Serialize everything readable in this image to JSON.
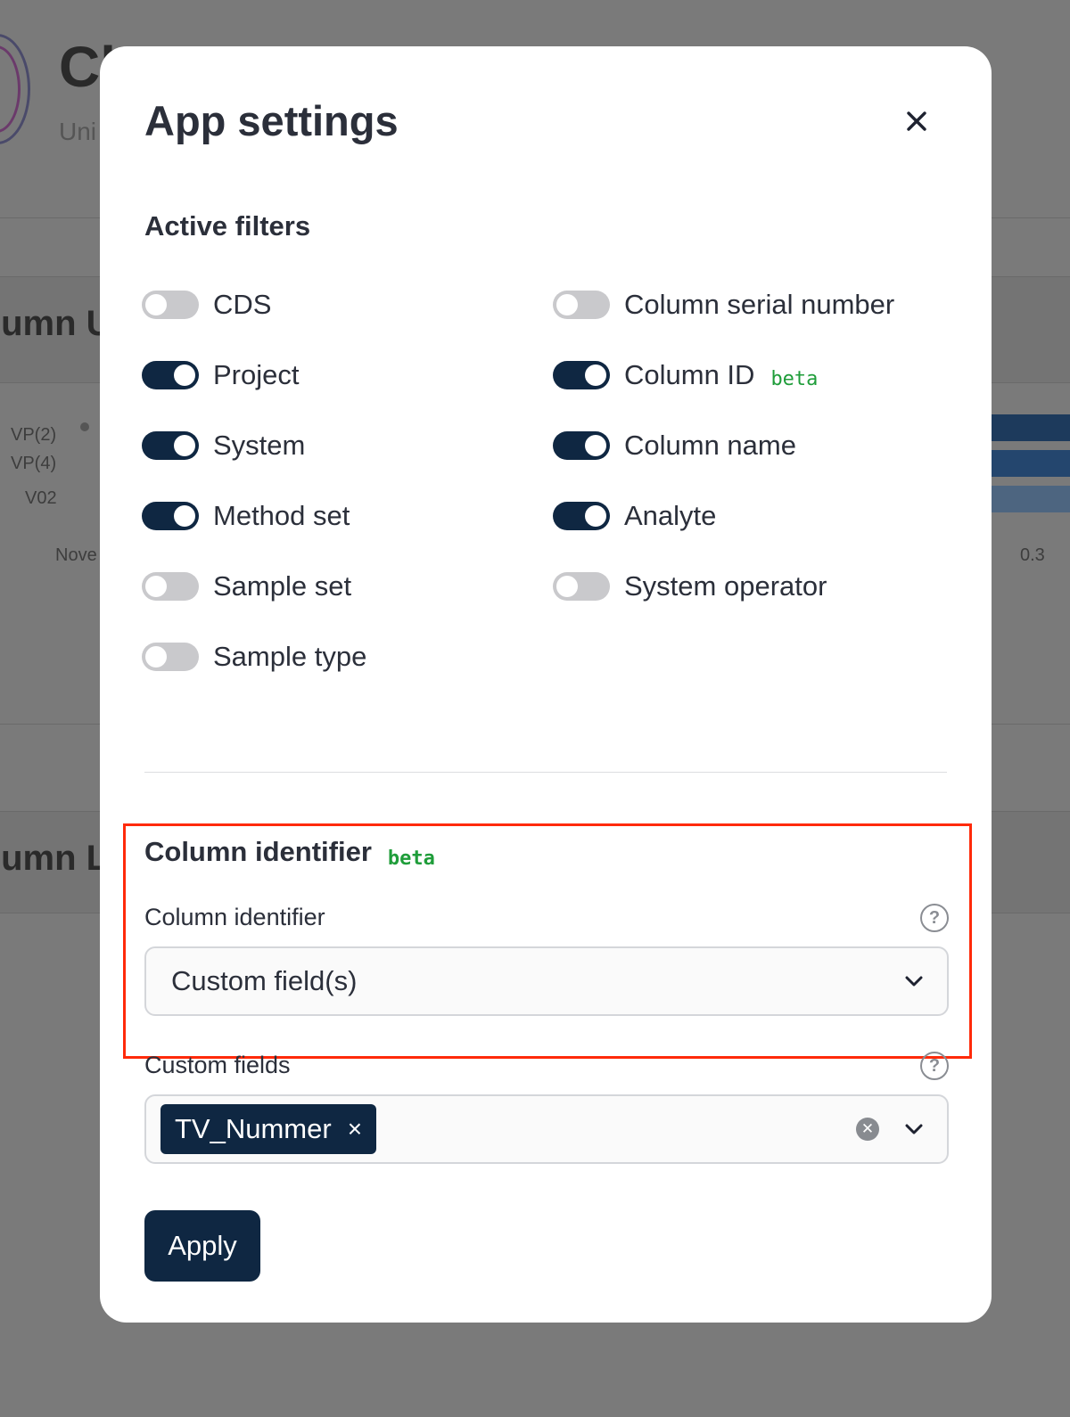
{
  "background": {
    "title": "Cl",
    "subtitle": "Uni",
    "section1_title": "lumn U",
    "section2_title": "lumn L",
    "axis_labels": [
      "VP(2)",
      "VP(4)",
      "V02"
    ],
    "x_axis_left": "Nove",
    "x_axis_right": "0.3"
  },
  "modal": {
    "title": "App settings",
    "close_icon": "close-icon",
    "active_filters": {
      "heading": "Active filters",
      "left": [
        {
          "label": "CDS",
          "enabled": false
        },
        {
          "label": "Project",
          "enabled": true
        },
        {
          "label": "System",
          "enabled": true
        },
        {
          "label": "Method set",
          "enabled": true
        },
        {
          "label": "Sample set",
          "enabled": false
        },
        {
          "label": "Sample type",
          "enabled": false
        }
      ],
      "right": [
        {
          "label": "Column serial number",
          "enabled": false
        },
        {
          "label": "Column ID",
          "enabled": true,
          "badge": "beta"
        },
        {
          "label": "Column name",
          "enabled": true
        },
        {
          "label": "Analyte",
          "enabled": true
        },
        {
          "label": "System operator",
          "enabled": false
        }
      ]
    },
    "column_identifier": {
      "heading": "Column identifier",
      "badge": "beta",
      "field_label": "Column identifier",
      "selected": "Custom field(s)"
    },
    "custom_fields": {
      "label": "Custom fields",
      "chips": [
        "TV_Nummer"
      ],
      "chip_remove": "×"
    },
    "apply_label": "Apply"
  },
  "colors": {
    "toggle_on": "#0f2742",
    "toggle_off": "#c9c9cc",
    "beta": "#1f9d3a",
    "highlight": "#ff2a0a"
  }
}
